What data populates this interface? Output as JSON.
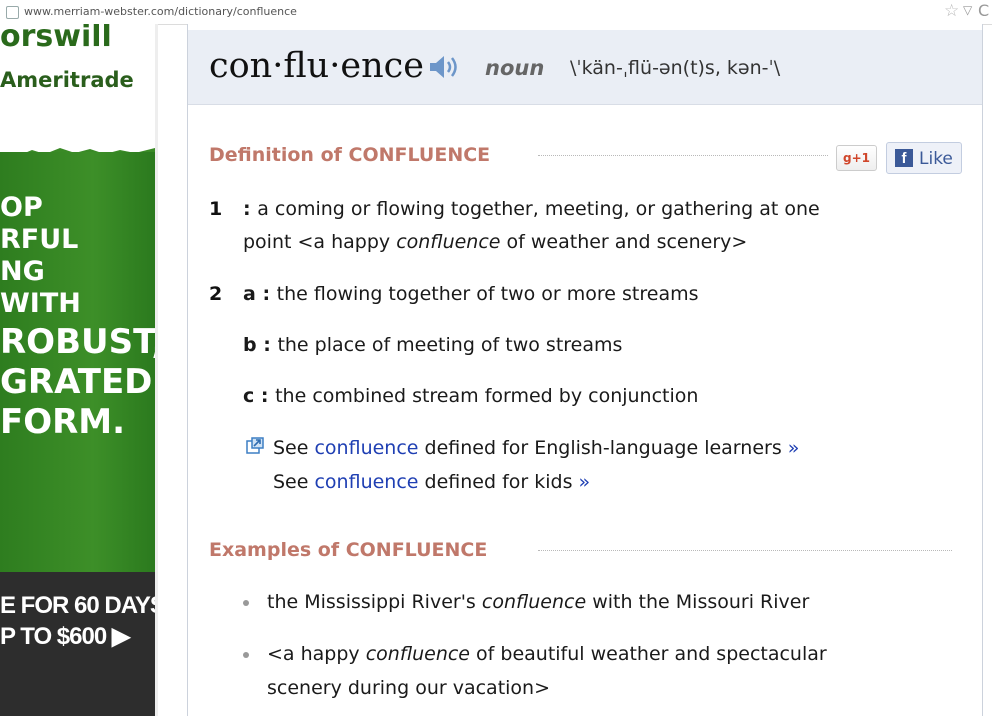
{
  "browser": {
    "url_host": "www.merriam-webster.com",
    "url_path": "/dictionary/confluence"
  },
  "ad": {
    "title_fragment": "orswill",
    "brand": "Ameritrade",
    "lines": [
      "OP",
      "RFUL",
      "NG",
      "WITH",
      "ROBUST,",
      "GRATED",
      "FORM."
    ],
    "cta_line1": "E FOR 60 DAYS",
    "cta_line2": "P TO $600 ▶"
  },
  "entry": {
    "headword": "con·flu·ence",
    "part_of_speech": "noun",
    "pronunciation": "\\ˈkän-ˌflü-ən(t)s, kən-ˈ\\"
  },
  "definition": {
    "title": "Definition of CONFLUENCE",
    "gplus_label": "+1",
    "like_label": "Like",
    "senses": [
      {
        "number": "1",
        "line1": "a coming or flowing together, meeting, or gathering at one",
        "line2_prefix": "point <a happy ",
        "line2_italic": "confluence",
        "line2_suffix": " of weather and scenery>"
      },
      {
        "number": "2",
        "letter": "a",
        "text": "the flowing together of two or more streams"
      },
      {
        "letter": "b",
        "text": "the place of meeting of two streams"
      },
      {
        "letter": "c",
        "text": "the combined stream formed by conjunction"
      }
    ],
    "see_learners": {
      "prefix": "See ",
      "link": "confluence",
      "suffix": " defined for English-language learners ",
      "chevron": "»"
    },
    "see_kids": {
      "prefix": "See ",
      "link": "confluence",
      "suffix": " defined for kids ",
      "chevron": "»"
    }
  },
  "examples": {
    "title": "Examples of CONFLUENCE",
    "items": [
      {
        "prefix": "the Mississippi River's ",
        "italic": "confluence",
        "suffix": " with the Missouri River"
      },
      {
        "prefix": "<a happy ",
        "italic": "confluence",
        "suffix": " of beautiful weather and spectacular",
        "line2": "scenery during our vacation>"
      }
    ]
  },
  "colors": {
    "section_title": "#c0786a",
    "link": "#1f3fb3",
    "header_bg": "#eaeef5",
    "ad_green": "#3d8f28"
  }
}
